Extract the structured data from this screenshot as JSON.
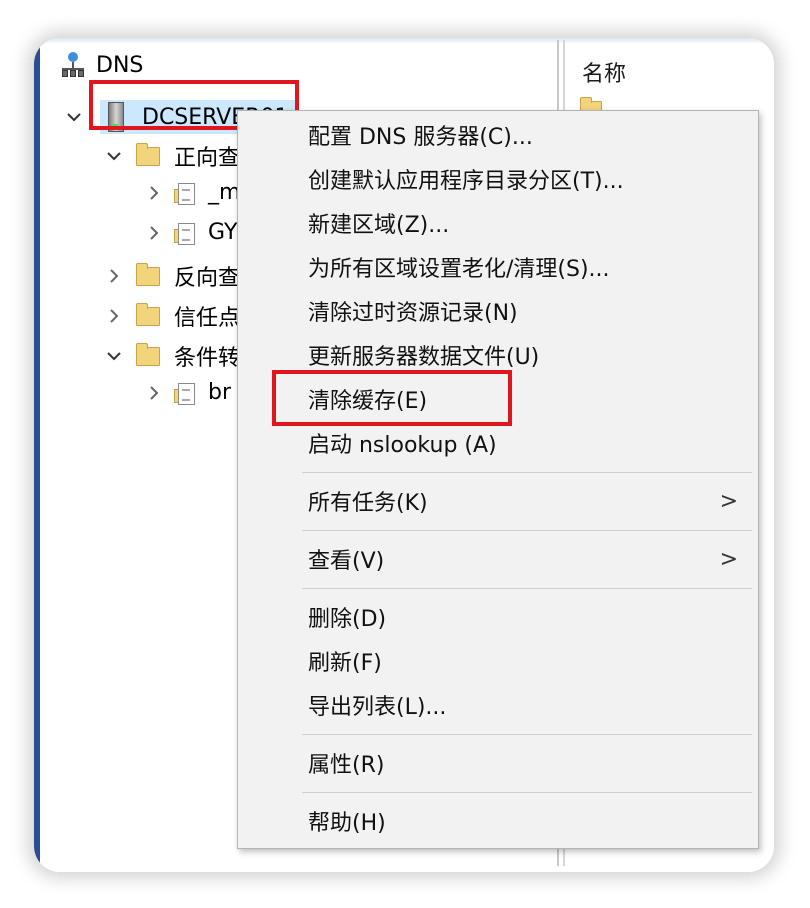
{
  "tree": {
    "root_label": "DNS",
    "server_label": "DCSERVER01",
    "nodes": [
      {
        "label": "正向查",
        "name": "forward-lookup"
      },
      {
        "label": "_m",
        "name": "zone-msdcs"
      },
      {
        "label": "GY",
        "name": "zone-gy"
      },
      {
        "label": "反向查",
        "name": "reverse-lookup"
      },
      {
        "label": "信任点",
        "name": "trust-points"
      },
      {
        "label": "条件转",
        "name": "conditional-forwarders"
      },
      {
        "label": "br",
        "name": "zone-br"
      }
    ]
  },
  "list": {
    "header": "名称"
  },
  "context_menu": {
    "items": [
      {
        "label": "配置 DNS 服务器(C)..."
      },
      {
        "label": "创建默认应用程序目录分区(T)..."
      },
      {
        "label": "新建区域(Z)..."
      },
      {
        "label": "为所有区域设置老化/清理(S)..."
      },
      {
        "label": "清除过时资源记录(N)"
      },
      {
        "label": "更新服务器数据文件(U)"
      },
      {
        "label": "清除缓存(E)"
      },
      {
        "label": "启动 nslookup (A)"
      },
      {
        "label": "所有任务(K)",
        "submenu_arrow": ">"
      },
      {
        "label": "查看(V)",
        "submenu_arrow": ">"
      },
      {
        "label": "删除(D)"
      },
      {
        "label": "刷新(F)"
      },
      {
        "label": "导出列表(L)..."
      },
      {
        "label": "属性(R)"
      },
      {
        "label": "帮助(H)"
      }
    ]
  },
  "colors": {
    "highlight_box": "#e0161e",
    "selection": "#cce8ff",
    "menu_bg": "#f2f2f2"
  }
}
